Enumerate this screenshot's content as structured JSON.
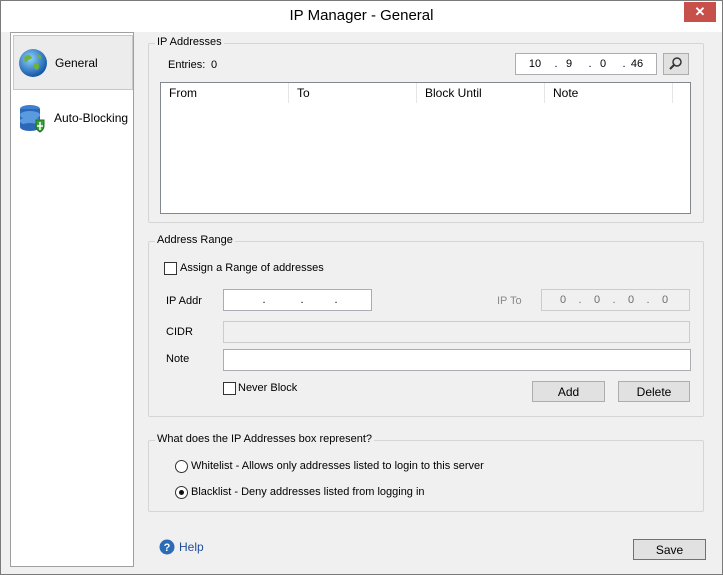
{
  "window": {
    "title": "IP Manager - General",
    "close_glyph": "✕"
  },
  "sidebar": {
    "items": [
      {
        "label": "General",
        "icon": "globe-icon",
        "selected": true
      },
      {
        "label": "Auto-Blocking",
        "icon": "database-shield-icon",
        "selected": false
      }
    ]
  },
  "ip_addresses": {
    "group_title": "IP Addresses",
    "entries_label": "Entries:",
    "entries_count": "0",
    "search_ip": [
      "10",
      "9",
      "0",
      "46"
    ],
    "columns": [
      "From",
      "To",
      "Block Until",
      "Note"
    ],
    "rows": []
  },
  "address_range": {
    "group_title": "Address Range",
    "assign_range_label": "Assign a Range of addresses",
    "assign_range_checked": false,
    "ip_addr_label": "IP Addr",
    "ip_addr_value": [
      "",
      "",
      "",
      ""
    ],
    "ip_to_label": "IP To",
    "ip_to_value": [
      "0",
      "0",
      "0",
      "0"
    ],
    "cidr_label": "CIDR",
    "cidr_value": "",
    "note_label": "Note",
    "note_value": "",
    "never_block_label": "Never Block",
    "never_block_checked": false,
    "add_label": "Add",
    "delete_label": "Delete"
  },
  "mode": {
    "group_title": "What does the IP Addresses box represent?",
    "whitelist_label": "Whitelist - Allows only addresses listed to login to this server",
    "blacklist_label": "Blacklist - Deny addresses listed from logging in",
    "selected": "blacklist"
  },
  "footer": {
    "help_label": "Help",
    "save_label": "Save"
  },
  "colors": {
    "close": "#c7504a",
    "help_icon": "#2b6cb7",
    "accent": "#3c7fb1"
  }
}
